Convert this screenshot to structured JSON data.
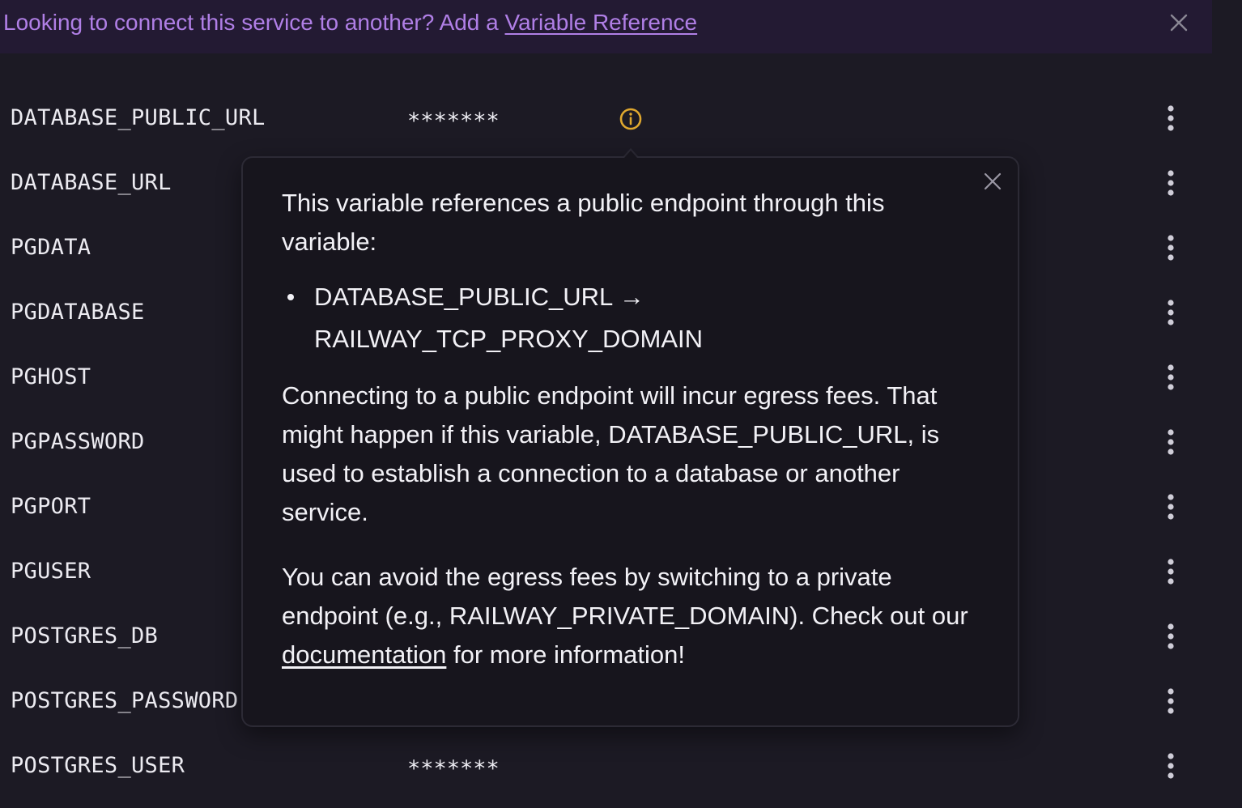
{
  "banner": {
    "text_prefix": "Looking to connect this service to another? Add a ",
    "link_label": "Variable Reference",
    "close_icon": "close-icon"
  },
  "variables": [
    {
      "name": "DATABASE_PUBLIC_URL",
      "value": "*******",
      "warning": true
    },
    {
      "name": "DATABASE_URL",
      "value": ""
    },
    {
      "name": "PGDATA",
      "value": ""
    },
    {
      "name": "PGDATABASE",
      "value": ""
    },
    {
      "name": "PGHOST",
      "value": ""
    },
    {
      "name": "PGPASSWORD",
      "value": ""
    },
    {
      "name": "PGPORT",
      "value": ""
    },
    {
      "name": "PGUSER",
      "value": ""
    },
    {
      "name": "POSTGRES_DB",
      "value": ""
    },
    {
      "name": "POSTGRES_PASSWORD",
      "value": ""
    },
    {
      "name": "POSTGRES_USER",
      "value": "*******"
    }
  ],
  "row_menu_icon": "more-vertical-icon",
  "warning_icon": "info-circle-icon",
  "popover": {
    "intro": "This variable references a public endpoint through this variable:",
    "references": [
      {
        "from": "DATABASE_PUBLIC_URL",
        "arrow": "→",
        "to": "RAILWAY_TCP_PROXY_DOMAIN"
      }
    ],
    "warning": "Connecting to a public endpoint will incur egress fees. That might happen if this variable, DATABASE_PUBLIC_URL, is used to establish a connection to a database or another service.",
    "avoid_prefix": "You can avoid the egress fees by switching to a private endpoint (e.g., RAILWAY_PRIVATE_DOMAIN). Check out our ",
    "avoid_link": "documentation",
    "avoid_suffix": " for more information!"
  },
  "colors": {
    "background": "#1c1a24",
    "banner_bg": "#231a33",
    "banner_text": "#b07fe6",
    "warning_icon": "#e0a82e",
    "popover_bg": "#17151d",
    "text": "#ecebf1"
  }
}
